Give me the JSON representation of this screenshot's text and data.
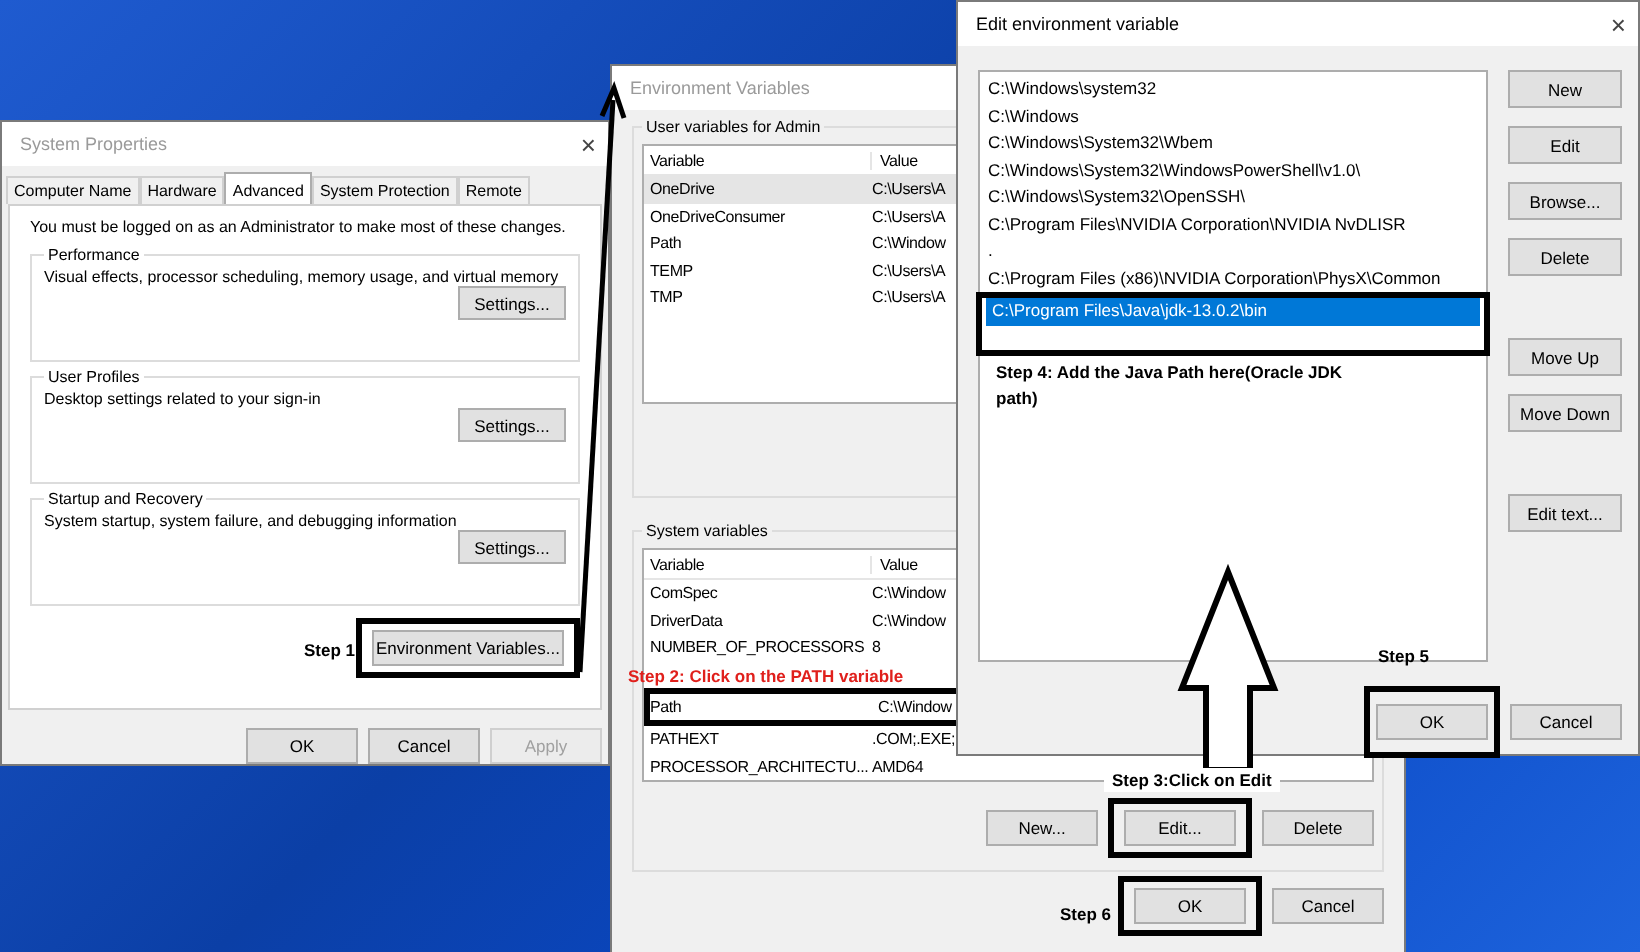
{
  "system_properties": {
    "title": "System Properties",
    "active": false,
    "close": "×",
    "tabs": [
      {
        "label": "Computer Name",
        "selected": false
      },
      {
        "label": "Hardware",
        "selected": false
      },
      {
        "label": "Advanced",
        "selected": true
      },
      {
        "label": "System Protection",
        "selected": false
      },
      {
        "label": "Remote",
        "selected": false
      }
    ],
    "notice": "You must be logged on as an Administrator to make most of these changes.",
    "groups": [
      {
        "title": "Performance",
        "description": "Visual effects, processor scheduling, memory usage, and virtual memory",
        "button": {
          "label": "Settings...",
          "disabled": false,
          "highlighted": false
        }
      },
      {
        "title": "User Profiles",
        "description": "Desktop settings related to your sign-in",
        "button": {
          "label": "Settings...",
          "disabled": false,
          "highlighted": false
        }
      },
      {
        "title": "Startup and Recovery",
        "description": "System startup, system failure, and debugging information",
        "button": {
          "label": "Settings...",
          "disabled": false,
          "highlighted": false
        }
      }
    ],
    "env_button": {
      "label": "Environment Variables...",
      "disabled": false,
      "highlighted": true
    },
    "buttons": [
      {
        "label": "OK",
        "disabled": false,
        "highlighted": false
      },
      {
        "label": "Cancel",
        "disabled": false,
        "highlighted": false
      },
      {
        "label": "Apply",
        "disabled": true,
        "highlighted": false
      }
    ]
  },
  "environment_variables": {
    "title": "Environment Variables",
    "active": false,
    "user_section": "User variables for Admin",
    "user_table": {
      "columns": [
        "Variable",
        "Value"
      ],
      "rows": [
        {
          "variable": "OneDrive",
          "value": "C:\\Users\\A",
          "selected": true,
          "highlighted": false
        },
        {
          "variable": "OneDriveConsumer",
          "value": "C:\\Users\\A",
          "selected": false,
          "highlighted": false
        },
        {
          "variable": "Path",
          "value": "C:\\Window",
          "selected": false,
          "highlighted": false
        },
        {
          "variable": "TEMP",
          "value": "C:\\Users\\A",
          "selected": false,
          "highlighted": false
        },
        {
          "variable": "TMP",
          "value": "C:\\Users\\A",
          "selected": false,
          "highlighted": false
        }
      ]
    },
    "system_section": "System variables",
    "system_table": {
      "columns": [
        "Variable",
        "Value"
      ],
      "rows": [
        {
          "variable": "ComSpec",
          "value": "C:\\Window",
          "highlighted": false
        },
        {
          "variable": "DriverData",
          "value": "C:\\Window",
          "highlighted": false
        },
        {
          "variable": "NUMBER_OF_PROCESSORS",
          "value": "8",
          "highlighted": false
        },
        {
          "variable": "Path",
          "value": "C:\\Window",
          "highlighted": true
        },
        {
          "variable": "PATHEXT",
          "value": ".COM;.EXE;",
          "highlighted": false
        },
        {
          "variable": "PROCESSOR_ARCHITECTU...",
          "value": "AMD64",
          "highlighted": false
        }
      ]
    },
    "system_buttons": [
      {
        "label": "New...",
        "disabled": false,
        "highlighted": false
      },
      {
        "label": "Edit...",
        "disabled": false,
        "highlighted": true
      },
      {
        "label": "Delete",
        "disabled": false,
        "highlighted": false
      }
    ],
    "buttons": [
      {
        "label": "OK",
        "disabled": false,
        "highlighted": true
      },
      {
        "label": "Cancel",
        "disabled": false,
        "highlighted": false
      }
    ]
  },
  "edit_dialog": {
    "title": "Edit environment variable",
    "active": true,
    "close": "×",
    "entries": [
      {
        "text": "C:\\Windows\\system32",
        "selected": false,
        "highlighted": false
      },
      {
        "text": "C:\\Windows",
        "selected": false,
        "highlighted": false
      },
      {
        "text": "C:\\Windows\\System32\\Wbem",
        "selected": false,
        "highlighted": false
      },
      {
        "text": "C:\\Windows\\System32\\WindowsPowerShell\\v1.0\\",
        "selected": false,
        "highlighted": false
      },
      {
        "text": "C:\\Windows\\System32\\OpenSSH\\",
        "selected": false,
        "highlighted": false
      },
      {
        "text": "C:\\Program Files\\NVIDIA Corporation\\NVIDIA NvDLISR",
        "selected": false,
        "highlighted": false
      },
      {
        "text": ".",
        "selected": false,
        "highlighted": false
      },
      {
        "text": "C:\\Program Files (x86)\\NVIDIA Corporation\\PhysX\\Common",
        "selected": false,
        "highlighted": false
      },
      {
        "text": "C:\\Program Files\\Java\\jdk-13.0.2\\bin",
        "selected": true,
        "highlighted": true
      }
    ],
    "side_buttons": [
      {
        "label": "New",
        "disabled": false,
        "highlighted": false
      },
      {
        "label": "Edit",
        "disabled": false,
        "highlighted": false
      },
      {
        "label": "Browse...",
        "disabled": false,
        "highlighted": false
      },
      {
        "label": "Delete",
        "disabled": false,
        "highlighted": false
      },
      {
        "label": "Move Up",
        "disabled": false,
        "highlighted": false
      },
      {
        "label": "Move Down",
        "disabled": false,
        "highlighted": false
      },
      {
        "label": "Edit text...",
        "disabled": false,
        "highlighted": false
      }
    ],
    "buttons": [
      {
        "label": "OK",
        "disabled": false,
        "highlighted": true
      },
      {
        "label": "Cancel",
        "disabled": false,
        "highlighted": false
      }
    ]
  },
  "annotations": [
    {
      "kind": "step",
      "text": "Step 4: Add the Java Path here(Oracle JDK path)",
      "color": "#000000"
    },
    {
      "kind": "step",
      "text": "Step 1",
      "color": "#000000"
    },
    {
      "kind": "step",
      "text": "Step 5",
      "color": "#000000"
    },
    {
      "kind": "step",
      "text": "Step 2: Click on the PATH variable",
      "color": "#e0201c"
    },
    {
      "kind": "step",
      "text": "Step 3:Click on Edit",
      "color": "#000000"
    },
    {
      "kind": "step",
      "text": "Step 6",
      "color": "#000000"
    }
  ]
}
